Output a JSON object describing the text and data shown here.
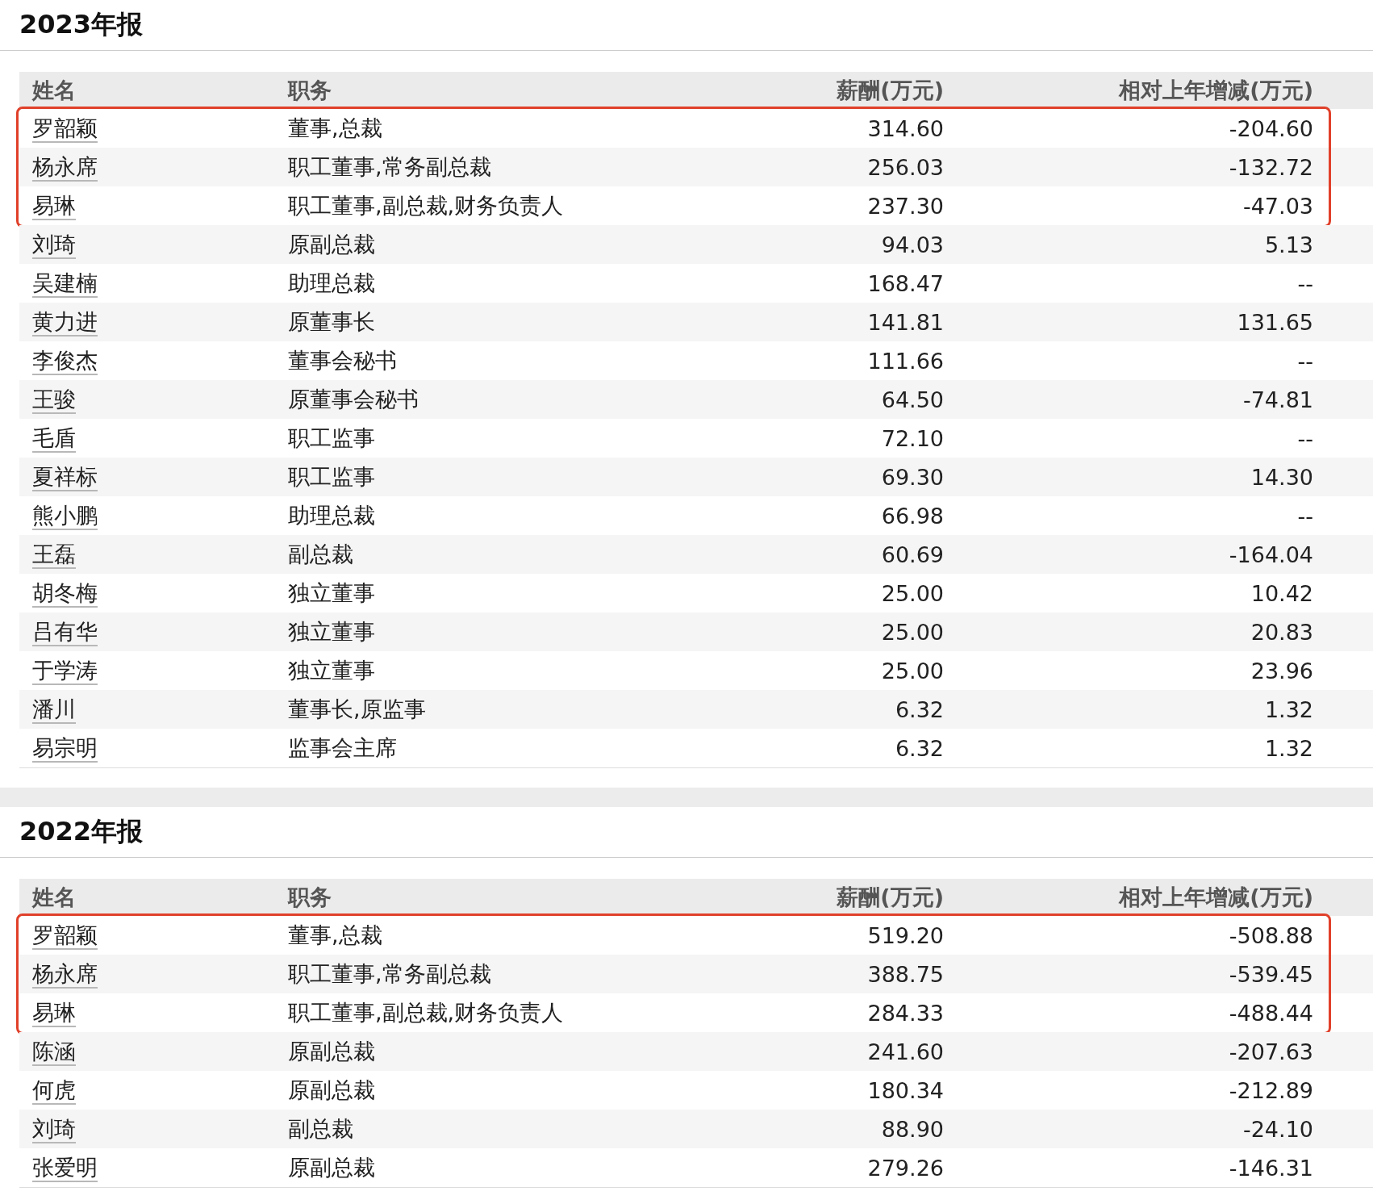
{
  "sections": [
    {
      "title": "2023年报",
      "columns": [
        "姓名",
        "职务",
        "薪酬(万元)",
        "相对上年增减(万元)"
      ],
      "rows": [
        {
          "name": "罗韶颖",
          "role": "董事,总裁",
          "pay": "314.60",
          "change": "-204.60",
          "highlighted": true
        },
        {
          "name": "杨永席",
          "role": "职工董事,常务副总裁",
          "pay": "256.03",
          "change": "-132.72",
          "highlighted": true
        },
        {
          "name": "易琳",
          "role": "职工董事,副总裁,财务负责人",
          "pay": "237.30",
          "change": "-47.03",
          "highlighted": true
        },
        {
          "name": "刘琦",
          "role": "原副总裁",
          "pay": "94.03",
          "change": "5.13",
          "highlighted": false
        },
        {
          "name": "吴建楠",
          "role": "助理总裁",
          "pay": "168.47",
          "change": "--",
          "highlighted": false
        },
        {
          "name": "黄力进",
          "role": "原董事长",
          "pay": "141.81",
          "change": "131.65",
          "highlighted": false
        },
        {
          "name": "李俊杰",
          "role": "董事会秘书",
          "pay": "111.66",
          "change": "--",
          "highlighted": false
        },
        {
          "name": "王骏",
          "role": "原董事会秘书",
          "pay": "64.50",
          "change": "-74.81",
          "highlighted": false
        },
        {
          "name": "毛盾",
          "role": "职工监事",
          "pay": "72.10",
          "change": "--",
          "highlighted": false
        },
        {
          "name": "夏祥标",
          "role": "职工监事",
          "pay": "69.30",
          "change": "14.30",
          "highlighted": false
        },
        {
          "name": "熊小鹏",
          "role": "助理总裁",
          "pay": "66.98",
          "change": "--",
          "highlighted": false
        },
        {
          "name": "王磊",
          "role": "副总裁",
          "pay": "60.69",
          "change": "-164.04",
          "highlighted": false
        },
        {
          "name": "胡冬梅",
          "role": "独立董事",
          "pay": "25.00",
          "change": "10.42",
          "highlighted": false
        },
        {
          "name": "吕有华",
          "role": "独立董事",
          "pay": "25.00",
          "change": "20.83",
          "highlighted": false
        },
        {
          "name": "于学涛",
          "role": "独立董事",
          "pay": "25.00",
          "change": "23.96",
          "highlighted": false
        },
        {
          "name": "潘川",
          "role": "董事长,原监事",
          "pay": "6.32",
          "change": "1.32",
          "highlighted": false
        },
        {
          "name": "易宗明",
          "role": "监事会主席",
          "pay": "6.32",
          "change": "1.32",
          "highlighted": false
        }
      ]
    },
    {
      "title": "2022年报",
      "columns": [
        "姓名",
        "职务",
        "薪酬(万元)",
        "相对上年增减(万元)"
      ],
      "rows": [
        {
          "name": "罗韶颖",
          "role": "董事,总裁",
          "pay": "519.20",
          "change": "-508.88",
          "highlighted": true
        },
        {
          "name": "杨永席",
          "role": "职工董事,常务副总裁",
          "pay": "388.75",
          "change": "-539.45",
          "highlighted": true
        },
        {
          "name": "易琳",
          "role": "职工董事,副总裁,财务负责人",
          "pay": "284.33",
          "change": "-488.44",
          "highlighted": true
        },
        {
          "name": "陈涵",
          "role": "原副总裁",
          "pay": "241.60",
          "change": "-207.63",
          "highlighted": false
        },
        {
          "name": "何虎",
          "role": "原副总裁",
          "pay": "180.34",
          "change": "-212.89",
          "highlighted": false
        },
        {
          "name": "刘琦",
          "role": "副总裁",
          "pay": "88.90",
          "change": "-24.10",
          "highlighted": false
        },
        {
          "name": "张爱明",
          "role": "原副总裁",
          "pay": "279.26",
          "change": "-146.31",
          "highlighted": false
        }
      ]
    }
  ]
}
